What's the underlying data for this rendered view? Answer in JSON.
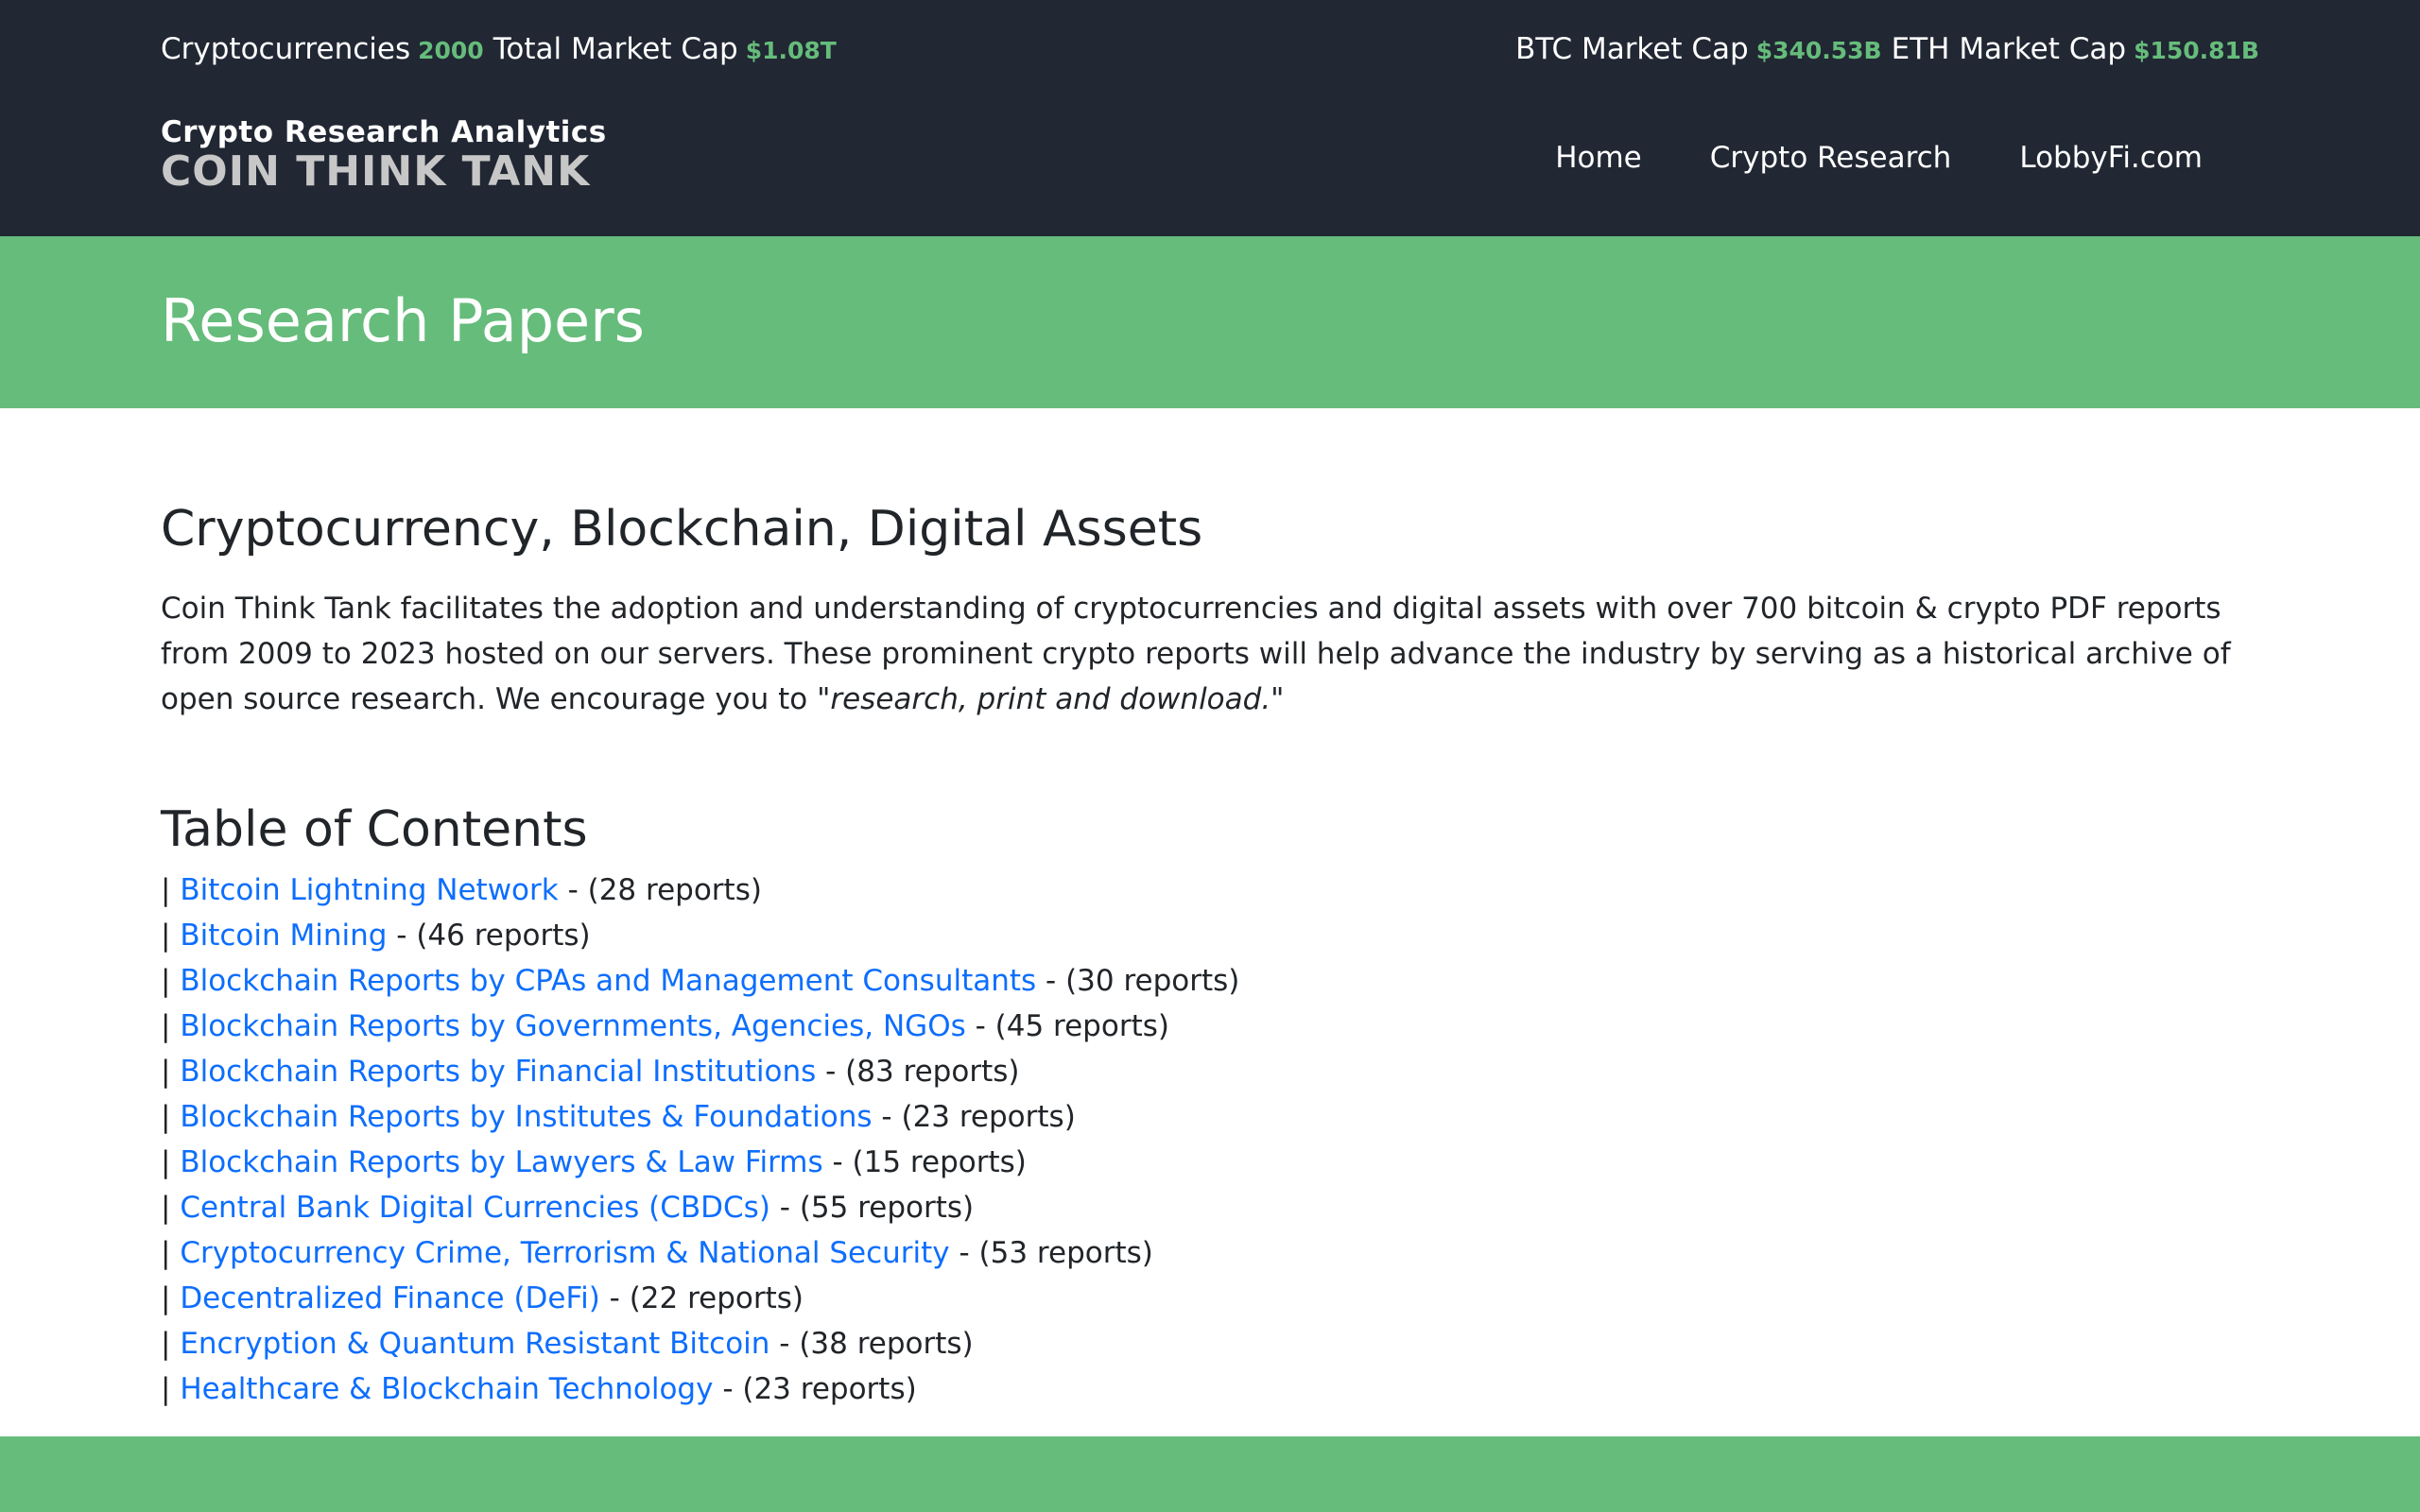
{
  "stats": {
    "cryptocurrencies_label": "Cryptocurrencies",
    "cryptocurrencies_value": "2000",
    "total_market_cap_label": "Total Market Cap",
    "total_market_cap_value": "$1.08T",
    "btc_market_cap_label": "BTC Market Cap",
    "btc_market_cap_value": "$340.53B",
    "eth_market_cap_label": "ETH Market Cap",
    "eth_market_cap_value": "$150.81B"
  },
  "logo": {
    "subtitle": "Crypto Research Analytics",
    "title": "COIN THINK TANK"
  },
  "nav": {
    "items": [
      {
        "label": "Home"
      },
      {
        "label": "Crypto Research"
      },
      {
        "label": "LobbyFi.com"
      }
    ]
  },
  "banner": {
    "title": "Research Papers"
  },
  "main": {
    "heading": "Cryptocurrency, Blockchain, Digital Assets",
    "intro_text": "Coin Think Tank facilitates the adoption and understanding of cryptocurrencies and digital assets with over 700 bitcoin & crypto PDF reports from 2009 to 2023 hosted on our servers. These prominent crypto reports will help advance the industry by serving as a historical archive of open source research. We encourage you to ",
    "intro_quote": "\"research, print and download.\"",
    "toc_heading": "Table of Contents",
    "toc_separator": "| ",
    "toc": [
      {
        "label": "Bitcoin Lightning Network",
        "count": " - (28 reports)"
      },
      {
        "label": "Bitcoin Mining",
        "count": " - (46 reports)"
      },
      {
        "label": "Blockchain Reports by CPAs and Management Consultants",
        "count": " - (30 reports)"
      },
      {
        "label": "Blockchain Reports by Governments, Agencies, NGOs",
        "count": " - (45 reports)"
      },
      {
        "label": "Blockchain Reports by Financial Institutions",
        "count": " - (83 reports)"
      },
      {
        "label": "Blockchain Reports by Institutes & Foundations",
        "count": " - (23 reports)"
      },
      {
        "label": "Blockchain Reports by Lawyers & Law Firms",
        "count": " - (15 reports)"
      },
      {
        "label": "Central Bank Digital Currencies (CBDCs)",
        "count": " - (55 reports)"
      },
      {
        "label": "Cryptocurrency Crime, Terrorism & National Security",
        "count": " - (53 reports)"
      },
      {
        "label": "Decentralized Finance (DeFi)",
        "count": " - (22 reports)"
      },
      {
        "label": "Encryption & Quantum Resistant Bitcoin",
        "count": " - (38 reports)"
      },
      {
        "label": "Healthcare & Blockchain Technology",
        "count": " - (23 reports)"
      }
    ]
  },
  "colors": {
    "header_bg": "#212733",
    "accent_green": "#66bc7b",
    "link_blue": "#0d6efd",
    "logo_gray": "#c7c7c7",
    "text_dark": "#212529"
  }
}
